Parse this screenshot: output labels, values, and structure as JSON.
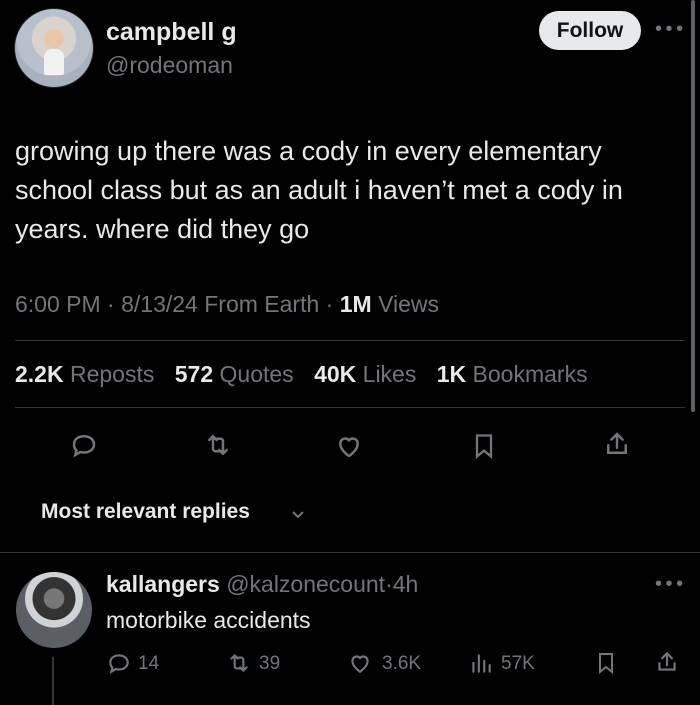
{
  "author": {
    "display_name": "campbell g",
    "handle": "@rodeoman",
    "follow_label": "Follow"
  },
  "tweet": {
    "text": "growing up there was a cody in every elementary school class but as an adult i haven’t met a cody in years. where did they go",
    "time": "6:00 PM",
    "date": "8/13/24",
    "location": "From Earth",
    "views_value": "1M",
    "views_label": "Views"
  },
  "stats": {
    "reposts_value": "2.2K",
    "reposts_label": "Reposts",
    "quotes_value": "572",
    "quotes_label": "Quotes",
    "likes_value": "40K",
    "likes_label": "Likes",
    "bookmarks_value": "1K",
    "bookmarks_label": "Bookmarks"
  },
  "actions": [
    "reply-icon",
    "repost-icon",
    "like-icon",
    "bookmark-icon",
    "share-icon"
  ],
  "replies_filter": {
    "label": "Most relevant replies"
  },
  "reply": {
    "display_name": "kallangers",
    "handle": "@kalzonecount",
    "time": "4h",
    "text": "motorbike accidents",
    "reply_count": "14",
    "repost_count": "39",
    "like_count": "3.6K",
    "view_count": "57K"
  },
  "colors": {
    "background": "#000000",
    "text": "#e7e9ea",
    "muted": "#71767b",
    "divider": "#2f3336"
  }
}
